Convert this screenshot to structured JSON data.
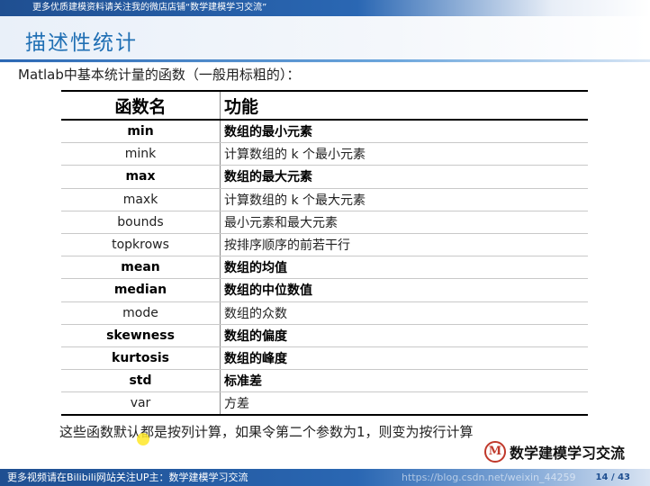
{
  "top_banner": "更多优质建模资料请关注我的微店店铺“数学建模学习交流”",
  "slide_title": "描述性统计",
  "intro_text": "Matlab中基本统计量的函数（一般用标粗的）：",
  "table": {
    "headers": [
      "函数名",
      "功能"
    ],
    "rows": [
      {
        "name": "min",
        "desc": "数组的最小元素",
        "bold": true
      },
      {
        "name": "mink",
        "desc": "计算数组的 k 个最小元素",
        "bold": false
      },
      {
        "name": "max",
        "desc": "数组的最大元素",
        "bold": true
      },
      {
        "name": "maxk",
        "desc": "计算数组的 k 个最大元素",
        "bold": false
      },
      {
        "name": "bounds",
        "desc": "最小元素和最大元素",
        "bold": false
      },
      {
        "name": "topkrows",
        "desc": "按排序顺序的前若干行",
        "bold": false
      },
      {
        "name": "mean",
        "desc": "数组的均值",
        "bold": true
      },
      {
        "name": "median",
        "desc": "数组的中位数值",
        "bold": true
      },
      {
        "name": "mode",
        "desc": "数组的众数",
        "bold": false
      },
      {
        "name": "skewness",
        "desc": "数组的偏度",
        "bold": true
      },
      {
        "name": "kurtosis",
        "desc": "数组的峰度",
        "bold": true
      },
      {
        "name": "std",
        "desc": "标准差",
        "bold": true
      },
      {
        "name": "var",
        "desc": "方差",
        "bold": false
      }
    ]
  },
  "note_text": "这些函数默认都是按列计算，如果令第二个参数为1，则变为按行计算",
  "brand": {
    "logo_letter": "M",
    "text": "数学建模学习交流"
  },
  "bottom_banner": "更多视频请在Bilibili网站关注UP主：数学建模学习交流",
  "watermark": "https://blog.csdn.net/weixin_44259",
  "page_indicator": "14 / 43",
  "colors": {
    "title_blue": "#1f6fb4",
    "bar_blue": "#2a67b3",
    "logo_red": "#c0392b"
  }
}
